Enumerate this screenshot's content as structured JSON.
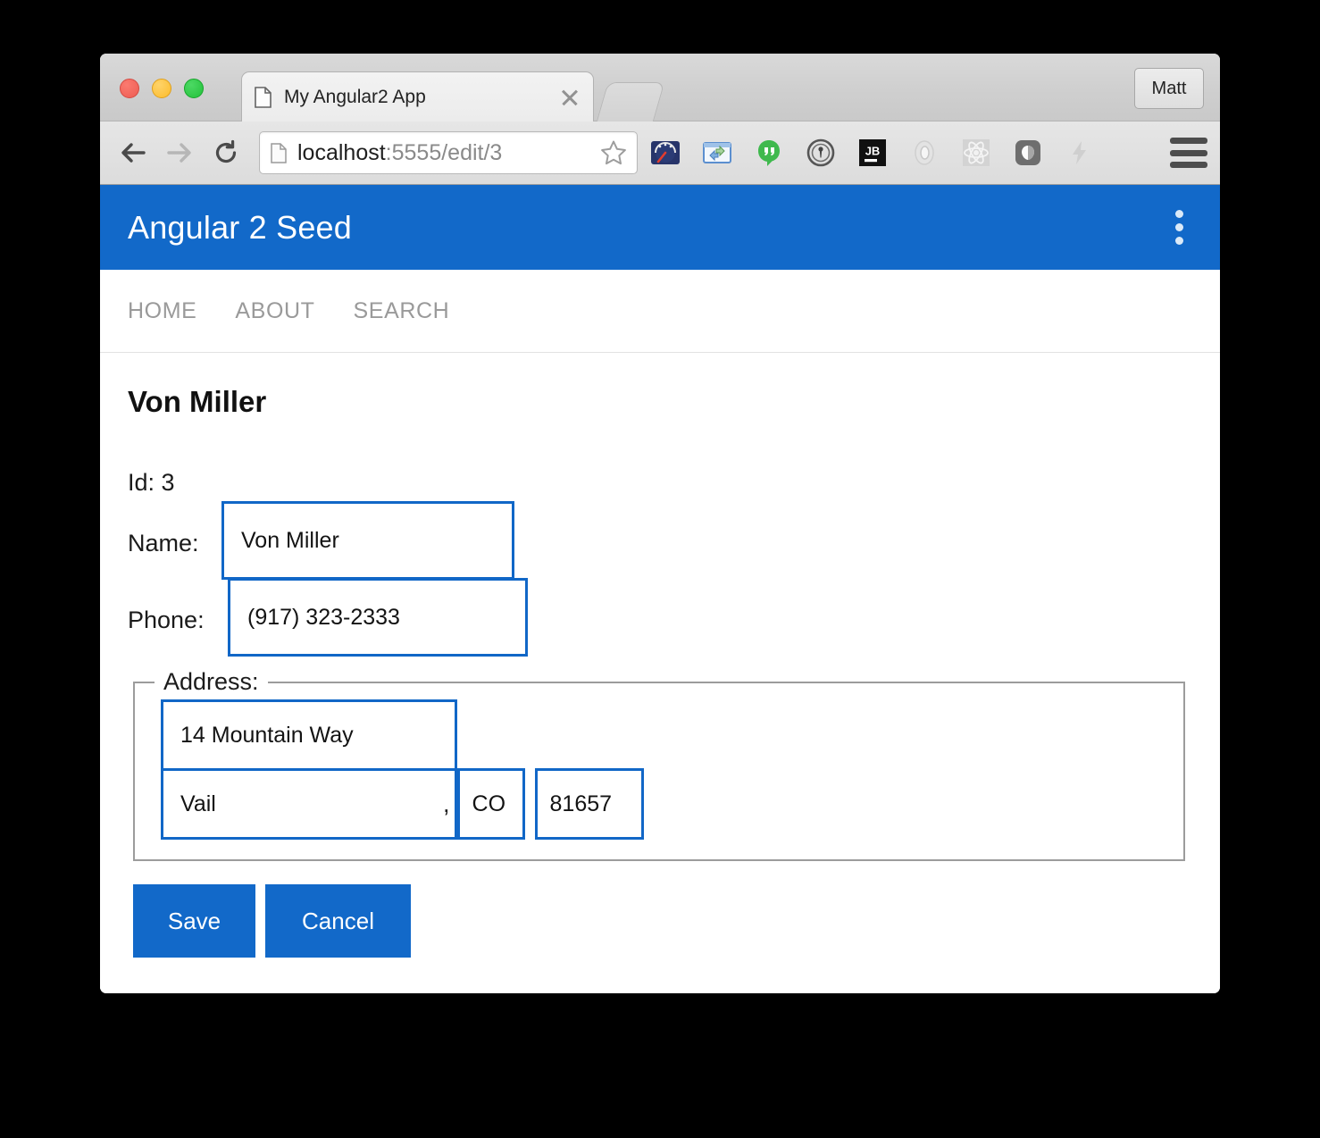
{
  "browser": {
    "tab": {
      "title": "My Angular2 App",
      "favicon_icon": "document-icon",
      "close_icon": "close-icon"
    },
    "new_tab_icon": "new-tab-icon",
    "profile_label": "Matt",
    "back_icon": "back-arrow-icon",
    "forward_icon": "forward-arrow-icon",
    "reload_icon": "reload-icon",
    "omnibox": {
      "favicon_icon": "document-icon",
      "host": "localhost",
      "path": ":5555/edit/3",
      "bookmark_icon": "star-icon"
    },
    "extensions": [
      {
        "name": "pagespeed-icon",
        "label": ""
      },
      {
        "name": "window-proxy-icon",
        "label": ""
      },
      {
        "name": "hangouts-icon",
        "label": ""
      },
      {
        "name": "onepassword-icon",
        "label": ""
      },
      {
        "name": "jetbrains-icon",
        "label": "JB"
      },
      {
        "name": "ring-icon",
        "label": ""
      },
      {
        "name": "react-devtools-icon",
        "label": ""
      },
      {
        "name": "shield-blob-icon",
        "label": ""
      },
      {
        "name": "lightning-icon",
        "label": ""
      }
    ],
    "menu_icon": "hamburger-menu-icon"
  },
  "app": {
    "title": "Angular 2 Seed",
    "overflow_icon": "kebab-menu-icon",
    "nav": [
      {
        "label": "HOME"
      },
      {
        "label": "ABOUT"
      },
      {
        "label": "SEARCH"
      }
    ]
  },
  "form": {
    "heading": "Von Miller",
    "id_label": "Id: 3",
    "name_label": "Name:",
    "name_value": "Von Miller",
    "name_placeholder": "",
    "phone_label": "Phone:",
    "phone_value": "(917) 323-2333",
    "phone_placeholder": "",
    "address_legend": "Address:",
    "street_value": "14 Mountain Way",
    "street_placeholder": "",
    "city_value": "Vail",
    "city_placeholder": "",
    "comma": ",",
    "state_value": "CO",
    "state_placeholder": "",
    "zip_value": "81657",
    "zip_placeholder": "",
    "save_label": "Save",
    "cancel_label": "Cancel"
  },
  "colors": {
    "brand_blue": "#1269c9",
    "input_border_blue": "#1167c7",
    "nav_text_gray": "#9a9a9a"
  }
}
